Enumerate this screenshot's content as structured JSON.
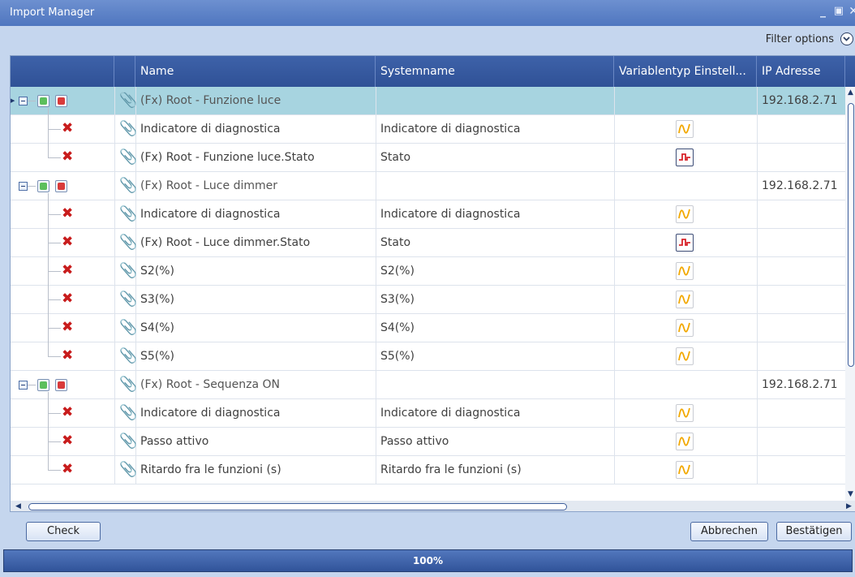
{
  "window": {
    "title": "Import Manager"
  },
  "filter": {
    "label": "Filter options"
  },
  "columns": {
    "name": "Name",
    "systemname": "Systemname",
    "variabletype": "Variablentyp Einstell...",
    "ip": "IP Adresse"
  },
  "rows": [
    {
      "kind": "group",
      "name": "(Fx) Root - Funzione luce",
      "systemname": "",
      "type": "",
      "ip": "192.168.2.71",
      "selected": true
    },
    {
      "kind": "item",
      "name": "Indicatore di diagnostica",
      "systemname": "Indicatore di diagnostica",
      "type": "analog",
      "ip": ""
    },
    {
      "kind": "item",
      "name": "(Fx) Root - Funzione luce.Stato",
      "systemname": "Stato",
      "type": "digital",
      "ip": ""
    },
    {
      "kind": "group",
      "name": "(Fx) Root - Luce dimmer",
      "systemname": "",
      "type": "",
      "ip": "192.168.2.71"
    },
    {
      "kind": "item",
      "name": "Indicatore di diagnostica",
      "systemname": "Indicatore di diagnostica",
      "type": "analog",
      "ip": ""
    },
    {
      "kind": "item",
      "name": "(Fx) Root - Luce dimmer.Stato",
      "systemname": "Stato",
      "type": "digital",
      "ip": ""
    },
    {
      "kind": "item",
      "name": "S2(%)",
      "systemname": "S2(%)",
      "type": "analog",
      "ip": ""
    },
    {
      "kind": "item",
      "name": "S3(%)",
      "systemname": "S3(%)",
      "type": "analog",
      "ip": ""
    },
    {
      "kind": "item",
      "name": "S4(%)",
      "systemname": "S4(%)",
      "type": "analog",
      "ip": ""
    },
    {
      "kind": "item",
      "name": "S5(%)",
      "systemname": "S5(%)",
      "type": "analog",
      "ip": ""
    },
    {
      "kind": "group",
      "name": "(Fx) Root - Sequenza ON",
      "systemname": "",
      "type": "",
      "ip": "192.168.2.71"
    },
    {
      "kind": "item",
      "name": "Indicatore di diagnostica",
      "systemname": "Indicatore di diagnostica",
      "type": "analog",
      "ip": ""
    },
    {
      "kind": "item",
      "name": "Passo attivo",
      "systemname": "Passo attivo",
      "type": "analog",
      "ip": ""
    },
    {
      "kind": "item",
      "name": "Ritardo fra le funzioni (s)",
      "systemname": "Ritardo fra le funzioni (s)",
      "type": "analog",
      "ip": ""
    }
  ],
  "buttons": {
    "check": "Check",
    "cancel": "Abbrechen",
    "confirm": "Bestätigen"
  },
  "progress": {
    "value": 1.0,
    "label": "100%"
  },
  "colors": {
    "analog_icon": "#f2a800",
    "digital_icon": "#d8232a",
    "selected_row": "#a7d4e0"
  }
}
